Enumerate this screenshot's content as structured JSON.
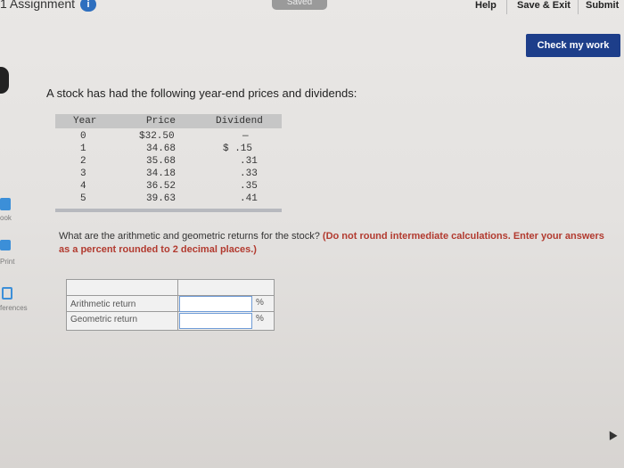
{
  "header": {
    "assignment_title": "1 Assignment",
    "assignment_badge": "i",
    "saved_text": "Saved",
    "help_label": "Help",
    "save_exit_label": "Save & Exit",
    "submit_label": "Submit",
    "check_label": "Check my work"
  },
  "left_rail": {
    "ebook_label": "ook",
    "print_label": "Print",
    "references_label": "ferences"
  },
  "question": {
    "intro": "A stock has had the following year-end prices and dividends:",
    "table": {
      "headers": [
        "Year",
        "Price",
        "Dividend"
      ],
      "rows": [
        [
          "0",
          "$32.50",
          "—"
        ],
        [
          "1",
          "34.68",
          "$ .15"
        ],
        [
          "2",
          "35.68",
          ".31"
        ],
        [
          "3",
          "34.18",
          ".33"
        ],
        [
          "4",
          "36.52",
          ".35"
        ],
        [
          "5",
          "39.63",
          ".41"
        ]
      ]
    },
    "prompt_plain": "What are the arithmetic and geometric returns for the stock?",
    "prompt_red": "(Do not round intermediate calculations. Enter your answers as a percent rounded to 2 decimal places.)"
  },
  "answers": {
    "rows": [
      {
        "label": "Arithmetic return",
        "value": "",
        "unit": "%"
      },
      {
        "label": "Geometric return",
        "value": "",
        "unit": "%"
      }
    ]
  },
  "colors": {
    "check_button": "#1d3e8a",
    "badge": "#2e6fbf",
    "instruction_red": "#b23a2f",
    "input_border": "#6e9bd6"
  }
}
